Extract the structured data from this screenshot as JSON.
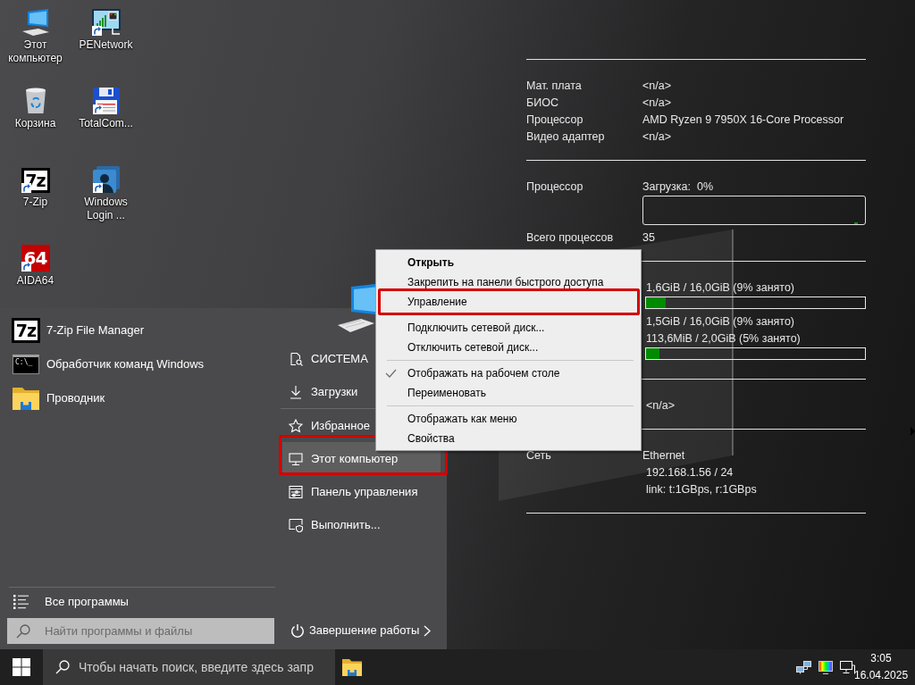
{
  "desktop_icons": [
    {
      "label": "Этот компьютер",
      "shortcut": false
    },
    {
      "label": "PENetwork",
      "shortcut": true
    },
    {
      "label": "Корзина",
      "shortcut": false
    },
    {
      "label": "TotalCom...",
      "shortcut": true
    },
    {
      "label": "7-Zip",
      "logo_text": "7z",
      "shortcut": true
    },
    {
      "label": "Windows Login ...",
      "shortcut": true
    },
    {
      "label": "AIDA64",
      "logo_text": "64",
      "shortcut": true
    }
  ],
  "system_info": {
    "sections": [
      {
        "rows": [
          {
            "kind": "text",
            "label": "Мат. плата",
            "value": "<n/a>"
          },
          {
            "kind": "text",
            "label": "БИОС",
            "value": "<n/a>"
          },
          {
            "kind": "text",
            "label": "Процессор",
            "value": "AMD Ryzen 9 7950X 16-Core Processor"
          },
          {
            "kind": "text",
            "label": "Видео адаптер",
            "value": "<n/a>"
          }
        ]
      },
      {
        "rows": [
          {
            "kind": "text",
            "label": "Процессор",
            "value": "Загрузка:  0%"
          },
          {
            "kind": "graph"
          },
          {
            "kind": "text",
            "label": "Всего процессов",
            "value": "35"
          }
        ]
      },
      {
        "rows": [
          {
            "kind": "text",
            "value": "1,6GiB / 16,0GiB (9% занято)"
          },
          {
            "kind": "bar",
            "level": 0.09
          },
          {
            "kind": "text",
            "value": "1,5GiB / 16,0GiB (9% занято)"
          },
          {
            "kind": "text",
            "value": "113,6MiB / 2,0GiB (5% занято)"
          },
          {
            "kind": "bar",
            "level": 0.06
          }
        ]
      },
      {
        "rows": [
          {
            "kind": "text",
            "value": "<n/a>"
          }
        ]
      },
      {
        "rows": [
          {
            "kind": "text",
            "label": "Сеть",
            "value": "Ethernet"
          },
          {
            "kind": "text",
            "value": "192.168.1.56 / 24"
          },
          {
            "kind": "text",
            "value": "link: t:1GBps, r:1GBps"
          }
        ]
      }
    ]
  },
  "start_menu": {
    "programs": [
      {
        "label": "7-Zip File Manager",
        "logo_text": "7z"
      },
      {
        "label": "Обработчик команд Windows",
        "logo_text": "C:\\_"
      },
      {
        "label": "Проводник"
      }
    ],
    "all_programs": "Все программы",
    "search": {
      "placeholder": "Найти программы и файлы"
    },
    "places": [
      {
        "kind": "item",
        "label": "СИСТЕМА",
        "selected": false,
        "highlighted": false
      },
      {
        "kind": "item",
        "label": "Загрузки",
        "selected": false,
        "highlighted": false
      },
      {
        "kind": "separator"
      },
      {
        "kind": "item",
        "label": "Избранное",
        "selected": false,
        "highlighted": false
      },
      {
        "kind": "item",
        "label": "Этот компьютер",
        "selected": true,
        "highlighted": true
      },
      {
        "kind": "item",
        "label": "Панель управления",
        "selected": false,
        "highlighted": false
      },
      {
        "kind": "item",
        "label": "Выполнить...",
        "selected": false,
        "highlighted": false
      }
    ],
    "shutdown": "Завершение работы"
  },
  "context_menu": {
    "items": [
      {
        "kind": "item",
        "label": "Открыть",
        "default": true,
        "checked": false,
        "highlighted": false
      },
      {
        "kind": "item",
        "label": "Закрепить на панели быстрого доступа",
        "default": false,
        "checked": false,
        "highlighted": false
      },
      {
        "kind": "item",
        "label": "Управление",
        "default": false,
        "checked": false,
        "highlighted": true
      },
      {
        "kind": "separator"
      },
      {
        "kind": "item",
        "label": "Подключить сетевой диск...",
        "default": false,
        "checked": false,
        "highlighted": false
      },
      {
        "kind": "item",
        "label": "Отключить сетевой диск...",
        "default": false,
        "checked": false,
        "highlighted": false
      },
      {
        "kind": "separator"
      },
      {
        "kind": "item",
        "label": "Отображать на рабочем столе",
        "default": false,
        "checked": true,
        "highlighted": false
      },
      {
        "kind": "item",
        "label": "Переименовать",
        "default": false,
        "checked": false,
        "highlighted": false
      },
      {
        "kind": "separator"
      },
      {
        "kind": "item",
        "label": "Отображать как меню",
        "default": false,
        "checked": false,
        "highlighted": false
      },
      {
        "kind": "item",
        "label": "Свойства",
        "default": false,
        "checked": false,
        "highlighted": false
      }
    ]
  },
  "taskbar": {
    "search": {
      "placeholder": "Чтобы начать поиск, введите здесь запр"
    },
    "clock": {
      "time": "3:05",
      "date": "16.04.2025"
    }
  }
}
